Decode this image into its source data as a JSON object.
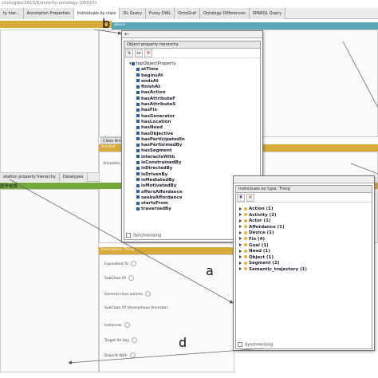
{
  "url_fragment": "ntologies/2015/6/activity-ontology-(00015)",
  "tabs": [
    {
      "label": "ty hier..."
    },
    {
      "label": "Annotation Properties"
    },
    {
      "label": "Individuals by class"
    },
    {
      "label": "DL Query"
    },
    {
      "label": "Fuzzy OWL"
    },
    {
      "label": "OntoGraf"
    },
    {
      "label": "Ontology Differences"
    },
    {
      "label": "SPARQL Query"
    }
  ],
  "bars": {
    "top_right": "图争蛙蝶",
    "top_teal": "ations",
    "lower_green": "图争蛙蝶",
    "right_mid": "图争蛙蝶"
  },
  "lower_tabs": [
    {
      "label": "otation property hierarchy"
    },
    {
      "label": "Datatypes"
    }
  ],
  "class_anno": {
    "tab": "Class Ann",
    "bar": "Annotat",
    "field": "Annotatio"
  },
  "obj_window": {
    "title": "Object property hierarchy:",
    "root": "topObjectProperty",
    "items": [
      "atTime",
      "beginsAt",
      "endsAt",
      "finishAt",
      "hasAction",
      "hasAttributeF",
      "hasAttributeS",
      "hasFix",
      "hasGenerator",
      "hasLocation",
      "hasNeed",
      "hasObjective",
      "hasParticipatedIn",
      "hasPerformedBy",
      "hasSegment",
      "interactsWith",
      "isConstrainedBy",
      "isDirectedBy",
      "isDrivenBy",
      "isMediatedBy",
      "isMotivatedBy",
      "offersAffordance",
      "seeksAffordance",
      "startsFrom",
      "traversedBy"
    ],
    "footer": "Synchronising"
  },
  "ind_window": {
    "title": "Individuals by type: Thing",
    "items": [
      "Action (1)",
      "Activity (2)",
      "Actor (1)",
      "Affordance (1)",
      "Device (1)",
      "Fix (4)",
      "Goal (1)",
      "Need (1)",
      "Object (1)",
      "Segment (2)",
      "Semantic_trajectory (1)"
    ],
    "footer": "Synchronising"
  },
  "description": {
    "title": "Description: Thing",
    "fields": [
      "Equivalent To",
      "SubClass Of",
      "General class axioms",
      "SubClass Of (Anonymous Ancestor)",
      "Instances",
      "Target for Key",
      "Disjoint With"
    ]
  },
  "callouts": {
    "a": "a",
    "b": "b",
    "d": "d"
  },
  "colors": {
    "yellow_bar": "#d7aa3a",
    "teal_bar": "#5aa6b4",
    "green_bar": "#74a83a",
    "prop_icon": "#2d5d9c",
    "class_icon": "#e2b23a"
  }
}
